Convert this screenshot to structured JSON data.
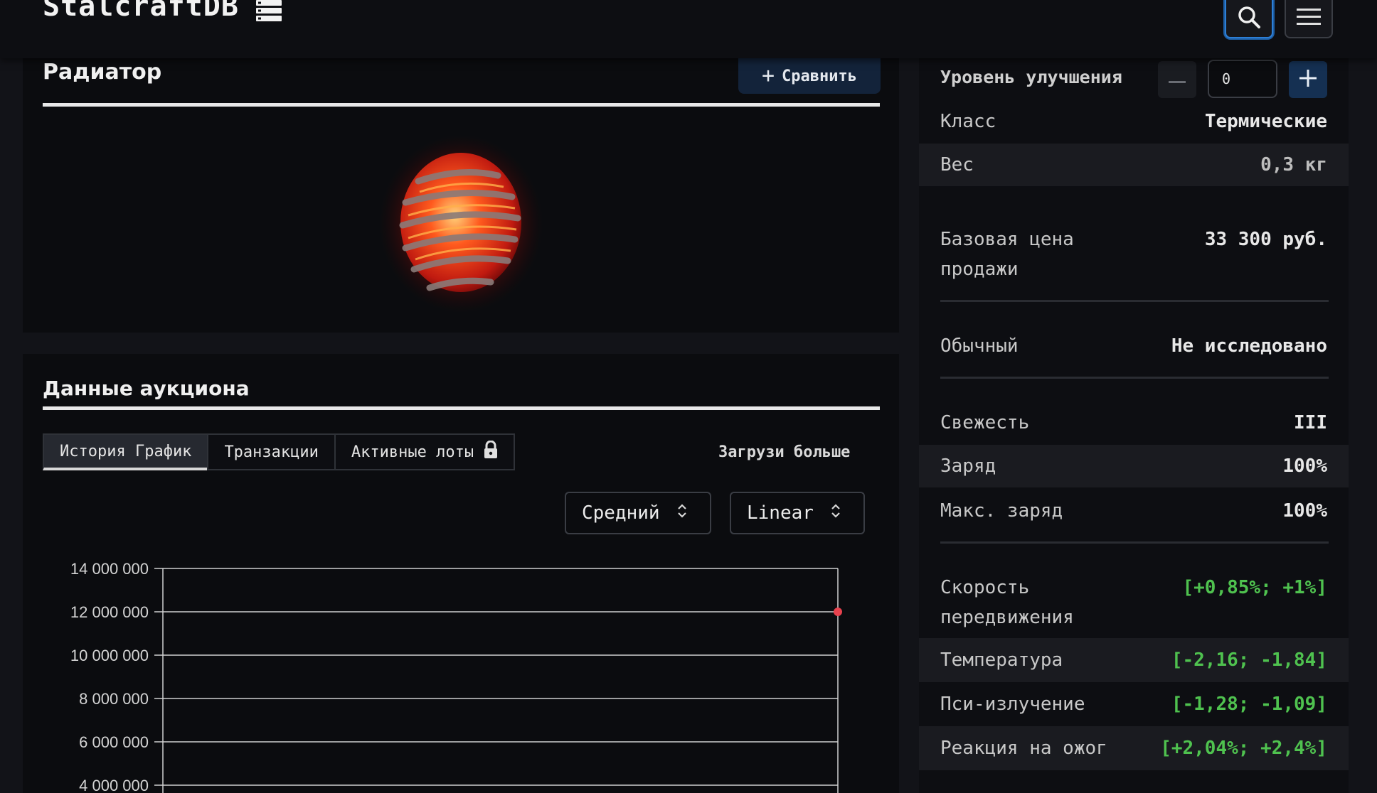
{
  "header": {
    "brand": "StalcraftDB",
    "icons": [
      "database-icon",
      "search-icon",
      "hamburger-menu-icon"
    ]
  },
  "item": {
    "title": "Радиатор",
    "compare_label": "Сравнить"
  },
  "auction": {
    "title": "Данные аукциона",
    "tabs": [
      {
        "label": "История График"
      },
      {
        "label": "Транзакции"
      },
      {
        "label": "Активные лоты"
      }
    ],
    "load_more": "Загрузи больше",
    "select_avg": "Средний",
    "select_scale": "Linear"
  },
  "upgrade": {
    "label": "Уровень улучшения",
    "value": "0"
  },
  "stats": {
    "class": {
      "k": "Класс",
      "v": "Термические"
    },
    "weight": {
      "k": "Вес",
      "v": "0,3 кг"
    },
    "base_price": {
      "k": "Базовая цена продажи",
      "v": "33 300 руб."
    },
    "rarity": {
      "k": "Обычный",
      "v": "Не исследовано"
    },
    "freshness": {
      "k": "Свежесть",
      "v": "III"
    },
    "charge": {
      "k": "Заряд",
      "v": "100%"
    },
    "max_charge": {
      "k": "Макс. заряд",
      "v": "100%"
    },
    "speed": {
      "k": "Скорость передвижения",
      "v": "[+0,85%; +1%]"
    },
    "temperature": {
      "k": "Температура",
      "v": "[-2,16; -1,84]"
    },
    "psi": {
      "k": "Пси-излучение",
      "v": "[-1,28; -1,09]"
    },
    "burn": {
      "k": "Реакция на ожог",
      "v": "[+2,04%; +2,4%]"
    }
  },
  "colors": {
    "accent_blue": "#2d7fd6",
    "positive_green": "#4fc24f",
    "point_red": "#e8424e"
  },
  "chart_data": {
    "type": "line",
    "y_ticks": [
      "14 000 000",
      "12 000 000",
      "10 000 000",
      "8 000 000",
      "6 000 000",
      "4 000 000"
    ],
    "y_tick_values": [
      14000000,
      12000000,
      10000000,
      8000000,
      6000000,
      4000000
    ],
    "ylim": [
      4000000,
      14000000
    ],
    "grid": true,
    "series": [
      {
        "values": [
          12000000
        ]
      }
    ]
  }
}
